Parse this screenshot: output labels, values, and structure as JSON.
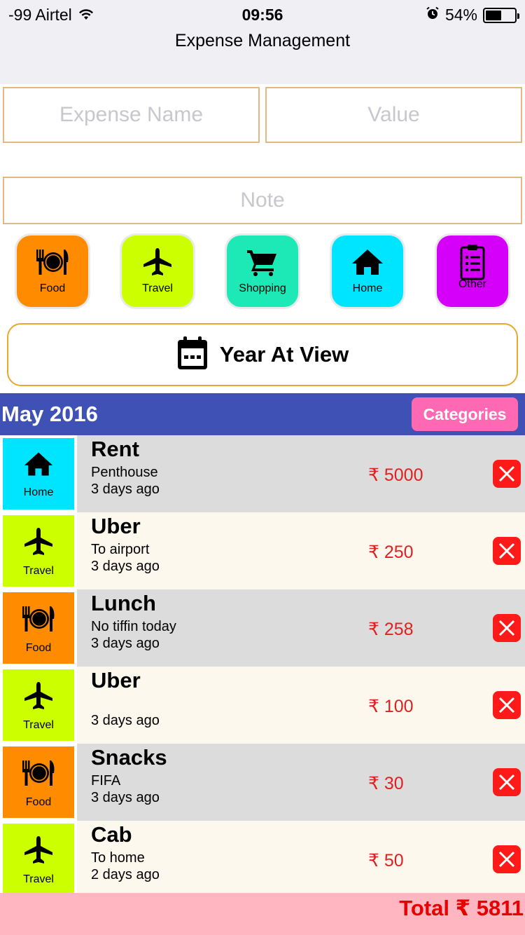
{
  "status_bar": {
    "carrier": "-99 Airtel",
    "time": "09:56",
    "battery": "54%",
    "battery_level": 0.54
  },
  "header": {
    "title": "Expense Management"
  },
  "form": {
    "expense_name_placeholder": "Expense Name",
    "value_placeholder": "Value",
    "note_placeholder": "Note"
  },
  "categories": [
    {
      "label": "Food",
      "color": "#ff8c00",
      "icon": "food-icon"
    },
    {
      "label": "Travel",
      "color": "#ccff00",
      "icon": "airplane-icon"
    },
    {
      "label": "Shopping",
      "color": "#1de9b6",
      "icon": "cart-icon"
    },
    {
      "label": "Home",
      "color": "#00e5ff",
      "icon": "home-icon"
    },
    {
      "label": "Other",
      "color": "#d500f9",
      "icon": "clipboard-icon"
    }
  ],
  "year_button": {
    "label": "Year At View",
    "icon": "calendar-icon"
  },
  "month_bar": {
    "label": "May 2016",
    "categories_button": "Categories",
    "color": "#3f51b5"
  },
  "expenses": [
    {
      "category": "Home",
      "name": "Rent",
      "note": "Penthouse",
      "ago": "3 days ago",
      "amount": "₹ 5000"
    },
    {
      "category": "Travel",
      "name": "Uber",
      "note": "To airport",
      "ago": "3 days ago",
      "amount": "₹ 250"
    },
    {
      "category": "Food",
      "name": "Lunch",
      "note": "No tiffin today",
      "ago": "3 days ago",
      "amount": "₹ 258"
    },
    {
      "category": "Travel",
      "name": "Uber",
      "note": "",
      "ago": "3 days ago",
      "amount": "₹ 100"
    },
    {
      "category": "Food",
      "name": "Snacks",
      "note": "FIFA",
      "ago": "3 days ago",
      "amount": "₹ 30"
    },
    {
      "category": "Travel",
      "name": "Cab",
      "note": "To home",
      "ago": "2 days ago",
      "amount": "₹ 50"
    }
  ],
  "total": {
    "label": "Total ₹ 5811"
  },
  "colors": {
    "row_gray": "#dcdcdc",
    "row_cream": "#fdf8ed",
    "amount_red": "#e02020",
    "delete_red": "#ff1a1a",
    "total_bg": "#ffb6c1",
    "field_border": "#e0b880",
    "year_border": "#e8a830"
  }
}
